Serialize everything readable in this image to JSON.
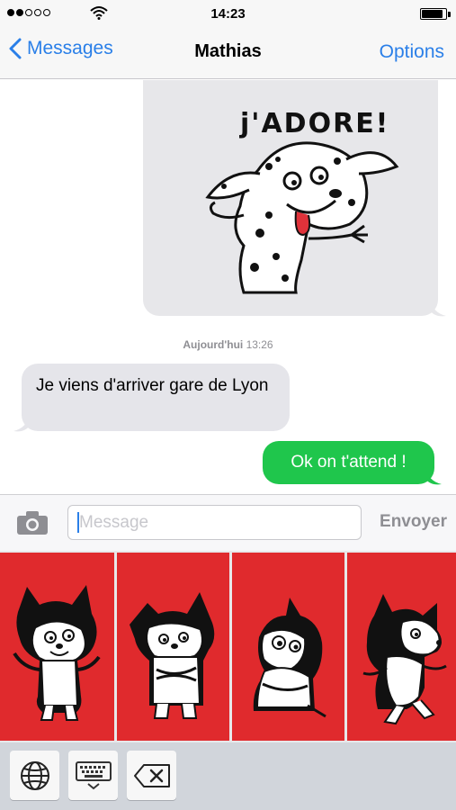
{
  "status_bar": {
    "time": "14:23",
    "signal_bars_filled": 2,
    "signal_bars_total": 5,
    "battery_level": 0.9
  },
  "nav": {
    "back_label": "Messages",
    "title": "Mathias",
    "options_label": "Options"
  },
  "conversation": {
    "sticker_message": {
      "sticker_text": "j'ADORE!",
      "sticker": "dalmatian-dog-sticker"
    },
    "timestamp_day": "Aujourd'hui",
    "timestamp_time": "13:26",
    "received_text": "Je viens d'arriver gare de Lyon",
    "sent_text": "Ok on t'attend !"
  },
  "input": {
    "placeholder": "Message",
    "value": "",
    "send_label": "Envoyer"
  },
  "sticker_keyboard": {
    "stickers": [
      "dog-waving-sticker",
      "dog-arms-crossed-sticker",
      "dog-sitting-sticker",
      "dog-walking-sticker"
    ],
    "background_color": "#e02a2d"
  },
  "keyboard_toolbar": {
    "icons": [
      "globe-icon",
      "keyboard-icon",
      "backspace-icon"
    ]
  },
  "colors": {
    "accent": "#2a7fe8",
    "sent_bubble": "#1fc64c",
    "received_bubble": "#e5e5ea"
  }
}
